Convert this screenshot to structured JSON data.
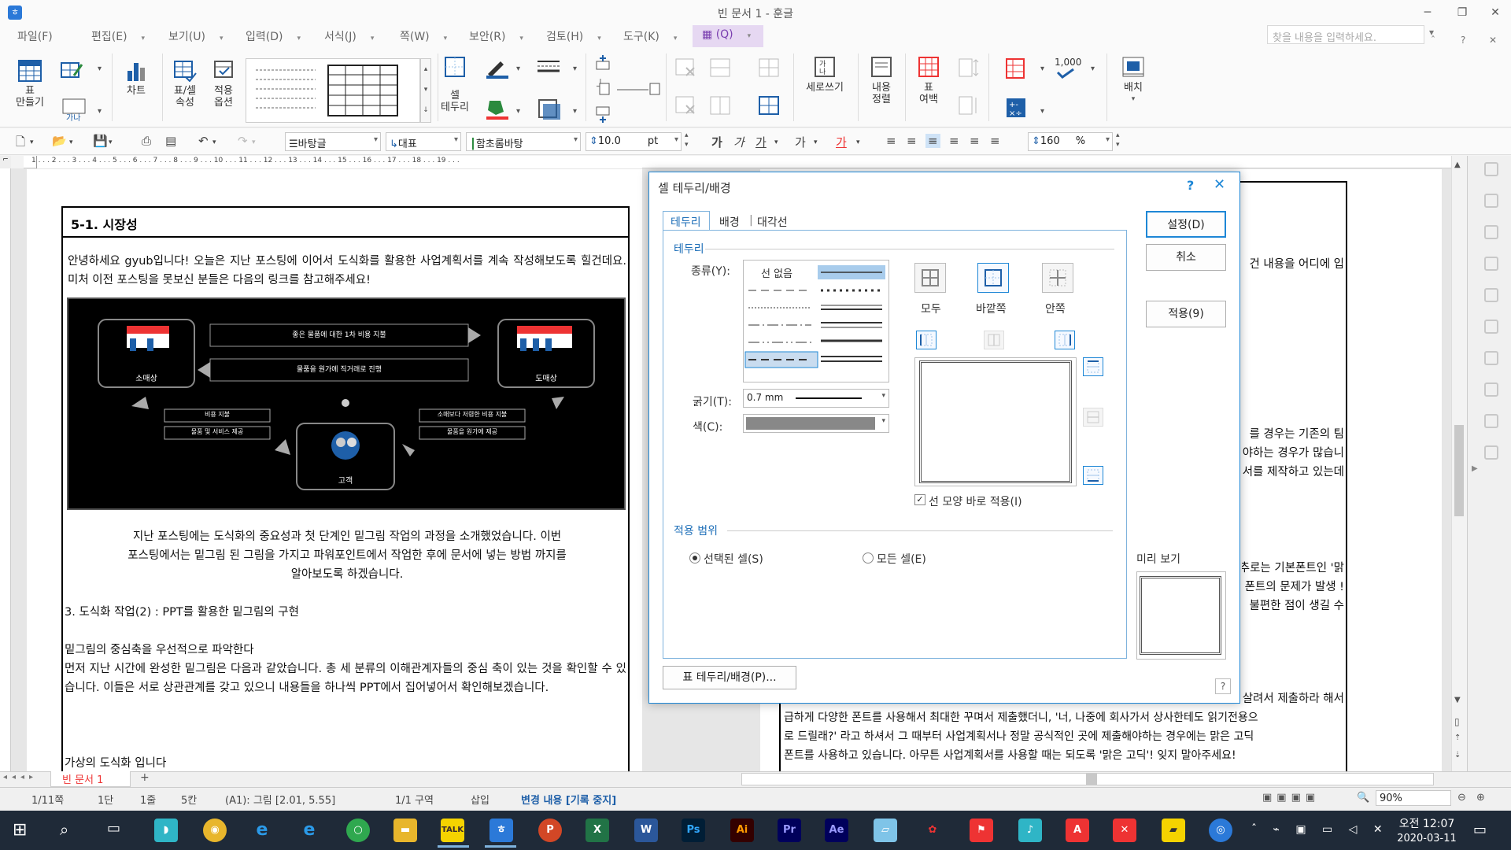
{
  "window": {
    "title": "빈 문서 1 - 훈글",
    "app_icon": "hwp-icon"
  },
  "menus": [
    {
      "label": "파일(F)"
    },
    {
      "label": "편집(E)"
    },
    {
      "label": "보기(U)"
    },
    {
      "label": "입력(D)"
    },
    {
      "label": "서식(J)"
    },
    {
      "label": "쪽(W)"
    },
    {
      "label": "보안(R)"
    },
    {
      "label": "검토(H)"
    },
    {
      "label": "도구(K)"
    },
    {
      "label": "(Q)"
    }
  ],
  "find_placeholder": "찾을 내용을 입력하세요.",
  "ribbon": {
    "table_make": "표\n만들기",
    "chart": "차트",
    "table_cell_props": "표/셀\n속성",
    "apply_options": "적용\n옵션",
    "cell_border": "셀\n테두리",
    "vertical_writing": "세로쓰기",
    "content_align": "내용\n정렬",
    "table_margin": "표\n여백",
    "arrange": "배치",
    "number_1000": "1,000"
  },
  "toolbar": {
    "style": "바탕글",
    "lang": "대표",
    "font": "함초롬바탕",
    "size": "10.0",
    "size_unit": "pt",
    "zoom_line": "160",
    "zoom_unit": "%",
    "ga1": "가",
    "ga2": "가",
    "ga3": "가",
    "ga4": "가",
    "ga5": "가"
  },
  "ruler_labels": "1 . . . 2 . . . 3 . . . 4 . . . 5 . . . 6 . . . 7 . . . 8 . . . 9 . . . 10 . . . 11 . . . 12 . . . 13 . . . 14 . . . 15 . . . 16 . . . 17 . . . 18 . . . 19 . . .",
  "document": {
    "heading": "5-1. 시장성",
    "intro": "안녕하세요 gyub입니다! 오늘은 지난 포스팅에 이어서 도식화를 활용한 사업계획서를 계속 작성해보도록 힐건데요. 미처 이전 포스팅을 못보신 분들은 다음의 링크를 참고해주세요!",
    "diagram": {
      "node_left": "소매상",
      "node_right": "도매상",
      "node_bottom": "고객",
      "top_label_1": "좋은 물품에 대한 1차 비용 지불",
      "top_label_2": "물품을 원가에 직거래로 진행",
      "left_label_1": "비용 지불",
      "left_label_2": "물품 및 서비스 제공",
      "right_label_1": "소매보다 저렴한 비용 지불",
      "right_label_2": "물품을 원가에 제공"
    },
    "para2_l1": "지난 포스팅에는 도식화의 중요성과 첫 단계인 밑그림 작업의 과정을 소개했었습니다. 이번",
    "para2_l2": "포스팅에서는 밑그림 된 그림을 가지고 파워포인트에서 작업한 후에 문서에 넣는 방법 까지를",
    "para2_l3": "알아보도록 하겠습니다.",
    "section3": "3. 도식화 작업(2) : PPT를 활용한 밑그림의 구현",
    "sub_heading": "밑그림의 중심축을 우선적으로 파악한다",
    "para3": "먼저 지난 시간에 완성한 밑그림은 다음과 같았습니다. 총 세 분류의 이해관계자들의 중심 축이 있는 것을 확인할 수 있습니다. 이들은 서로 상관관계를 갖고 있으니 내용들을 하나씩 PPT에서 집어넣어서 확인해보겠습니다.",
    "para4": "가상의 도식화 입니다",
    "right_frag_1": "건 내용을 어디에 입",
    "right_frag_2a": "를 경우는 기존의 팀",
    "right_frag_2b": "야하는 경우가 많습니",
    "right_frag_2c": "서를 제작하고 있는데",
    "right_frag_3a": "추로는 기본폰트인 '맑",
    "right_frag_3b": "! 폰트의 문제가 발생",
    "right_frag_3c": "불편한 점이 생길 수",
    "right_frag_4": "을 살려서 제출하라 해서",
    "right_line_5": "급하게 다양한 폰트를 사용해서 최대한 꾸며서 제출했더니, '너, 나중에 회사가서 상사한테도 읽기전용으",
    "right_line_6": "로 드릴래?' 라고 하셔서 그 때부터 사업계획서나 정말 공식적인 곳에 제출해야하는 경우에는 맑은 고딕",
    "right_line_7": "폰트를 사용하고 있습니다. 아무튼 사업계획서를 사용할 때는 되도록 '맑은 고딕'! 잊지 말아주세요!"
  },
  "dialog": {
    "title": "셀 테두리/배경",
    "help": "?",
    "tabs": [
      "테두리",
      "배경",
      "대각선"
    ],
    "border_section": "테두리",
    "type_label": "종류(Y):",
    "no_line": "선 없음",
    "all_label": "모두",
    "outside_label": "바깥쪽",
    "inside_label": "안쪽",
    "thickness_label": "굵기(T):",
    "thickness_value": "0.7 mm",
    "color_label": "색(C):",
    "apply_shape_checkbox": "선 모양 바로 적용(I)",
    "apply_scope_section": "적용 범위",
    "radio_selected_cell": "선택된 셀(S)",
    "radio_all_cells": "모든 셀(E)",
    "preview_label": "미리 보기",
    "set_button": "설정(D)",
    "cancel_button": "취소",
    "apply_button": "적용(9)",
    "table_border_button": "표 테두리/배경(P)...",
    "help_corner": "?"
  },
  "tabs_bottom": {
    "doc_tab": "빈 문서 1",
    "add": "+"
  },
  "status": {
    "page": "1/11쪽",
    "column": "1단",
    "line": "1줄",
    "col": "5칸",
    "cell": "(A1): 그림 [2.01, 5.55]",
    "section": "1/1 구역",
    "mode": "삽입",
    "track": "변경 내용 [기록 중지]",
    "zoom": "90%"
  },
  "taskbar": {
    "time": "오전 12:07",
    "date": "2020-03-11"
  },
  "colors": {
    "accent": "#1e87d6",
    "menu_active": "#e6d8f2",
    "taskbar": "#1f2a38"
  }
}
